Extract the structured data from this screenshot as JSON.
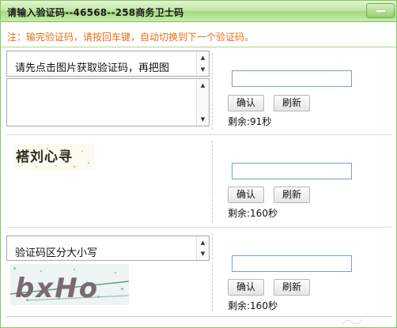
{
  "window": {
    "title": "请输入验证码--46568--258商务卫士码"
  },
  "notice": "注：输完验证码，请按回车键，自动切换到下一个验证码。",
  "rows": [
    {
      "textarea_text": "请先点击图片获取验证码，再把图",
      "input_value": "",
      "ok_label": "确认",
      "refresh_label": "刷新",
      "remaining": "剩余:91秒"
    },
    {
      "captcha_text": "褡刘心寻",
      "input_value": "",
      "ok_label": "确认",
      "refresh_label": "刷新",
      "remaining": "剩余:160秒"
    },
    {
      "textarea_text": "验证码区分大小写",
      "captcha_text": "bxHo",
      "input_value": "",
      "ok_label": "确认",
      "refresh_label": "刷新",
      "remaining": "剩余:160秒"
    }
  ],
  "colors": {
    "title_bg": "#b9e39b",
    "notice_text": "#e2701c",
    "input_border": "#7a9cd3"
  }
}
